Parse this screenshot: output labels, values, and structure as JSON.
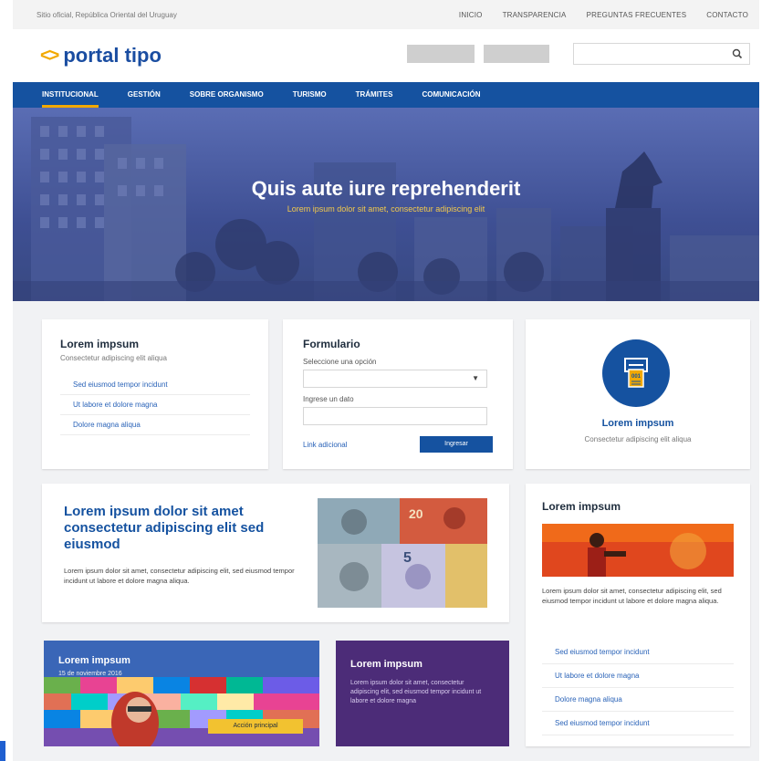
{
  "topbar": {
    "official": "Sitio oficial, República Oriental del Uruguay",
    "links": [
      "INICIO",
      "TRANSPARENCIA",
      "PREGUNTAS FRECUENTES",
      "CONTACTO"
    ]
  },
  "header": {
    "logo_mark": "<>",
    "logo_text": "portal tipo",
    "search_placeholder": ""
  },
  "nav": {
    "items": [
      "INSTITUCIONAL",
      "GESTIÓN",
      "SOBRE ORGANISMO",
      "TURISMO",
      "TRÁMITES",
      "COMUNICACIÓN"
    ],
    "active": "INSTITUCIONAL"
  },
  "hero": {
    "title": "Quis aute iure reprehenderit",
    "subtitle": "Lorem ipsum dolor sit amet, consectetur adipiscing elit"
  },
  "card_links": {
    "title": "Lorem impsum",
    "subtitle": "Consectetur adipiscing elit aliqua",
    "links": [
      "Sed eiusmod tempor incidunt",
      "Ut labore et dolore magna",
      "Dolore magna aliqua"
    ]
  },
  "card_form": {
    "title": "Formulario",
    "select_label": "Seleccione una opción",
    "select_value": "",
    "input_label": "Ingrese un dato",
    "input_value": "",
    "extra_link": "Link adicional",
    "submit": "Ingresar"
  },
  "card_icon": {
    "title": "Lorem impsum",
    "subtitle": "Consectetur adipiscing elit aliqua",
    "icon_text": "001"
  },
  "card_feature": {
    "title": "Lorem ipsum dolor sit amet consectetur adipiscing elit sed eiusmod",
    "body": "Lorem ipsum dolor sit amet, consectetur adipiscing elit, sed eiusmod tempor incidunt ut labore et dolore magna aliqua.",
    "image_numbers": [
      "20",
      "5"
    ]
  },
  "card_side": {
    "title": "Lorem impsum",
    "body": "Lorem ipsum dolor sit amet, consectetur adipiscing elit, sed eiusmod tempor incidunt ut labore et dolore magna aliqua.",
    "links": [
      "Sed eiusmod tempor incidunt",
      "Ut labore et dolore magna",
      "Dolore magna aliqua",
      "Sed eiusmod tempor incidunt"
    ]
  },
  "card_promo": {
    "title": "Lorem impsum",
    "date": "15 de noviembre 2016",
    "button": "Acción principal"
  },
  "card_purple": {
    "title": "Lorem impsum",
    "body": "Lorem ipsum dolor sit amet, consectetur adipiscing elit, sed eiusmod tempor incidunt ut labore et dolore magna"
  },
  "colors": {
    "primary": "#1552a0",
    "accent": "#f2a900",
    "purple": "#4c2c78",
    "background": "#f1f2f4"
  }
}
